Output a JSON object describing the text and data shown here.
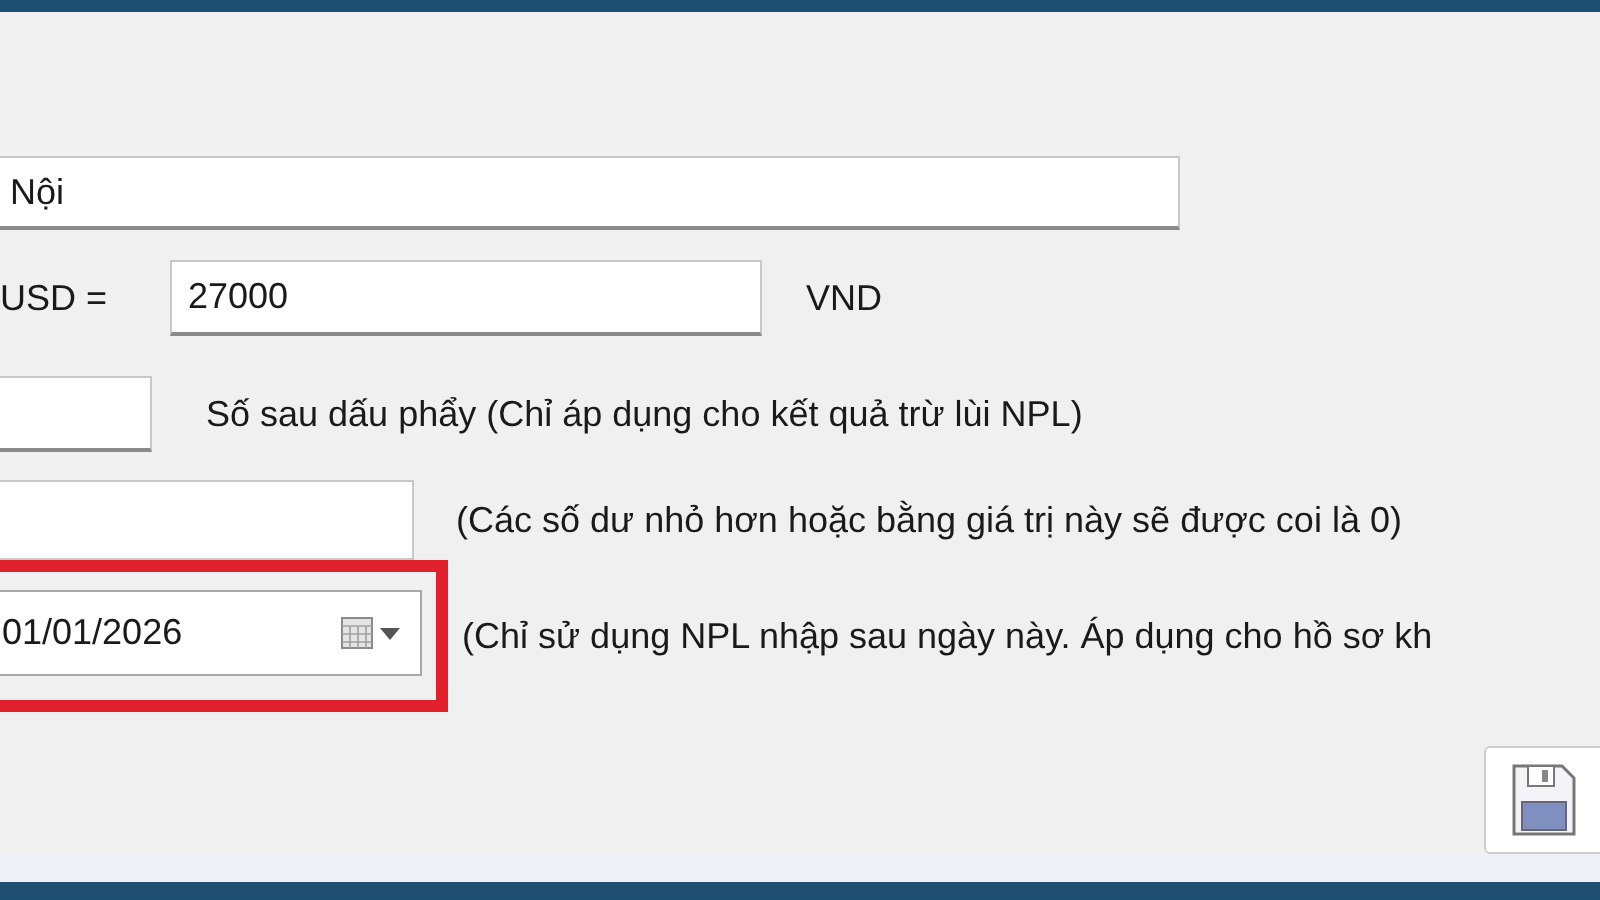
{
  "location_field": {
    "value": "Nội"
  },
  "exchange_rate": {
    "label": "USD =",
    "value": "27000",
    "unit": "VND"
  },
  "decimal_places": {
    "hint": "Số sau dấu phẩy (Chỉ áp dụng cho kết quả trừ lùi NPL)"
  },
  "residual_threshold": {
    "hint": "(Các số dư nhỏ hơn hoặc bằng giá trị này sẽ được coi là 0)"
  },
  "start_date": {
    "value": "01/01/2026",
    "hint": "(Chỉ sử dụng NPL nhập sau ngày này. Áp dụng cho hồ sơ kh",
    "highlighted": true
  }
}
